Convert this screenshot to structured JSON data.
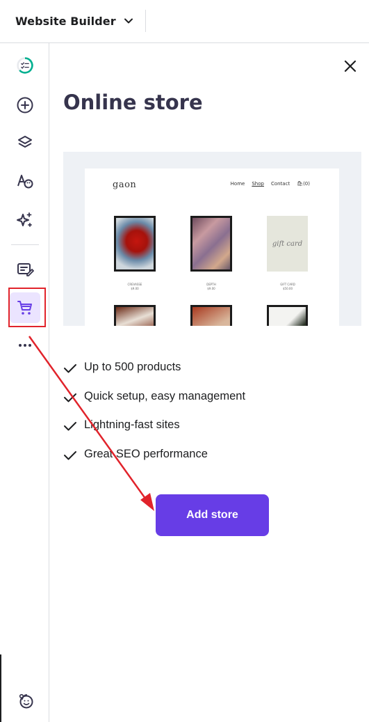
{
  "topbar": {
    "site_switcher_label": "Website Builder"
  },
  "rail": {
    "items": [
      {
        "name": "checklist",
        "icon": "progress-checklist-icon"
      },
      {
        "name": "add-elements",
        "icon": "plus-circle-icon"
      },
      {
        "name": "pages",
        "icon": "layers-icon"
      },
      {
        "name": "styles",
        "icon": "palette-icon"
      },
      {
        "name": "ai-tools",
        "icon": "sparkles-icon"
      },
      {
        "name": "blog",
        "icon": "edit-note-icon"
      },
      {
        "name": "online-store",
        "icon": "cart-icon",
        "active": true
      },
      {
        "name": "more",
        "icon": "more-dots-icon"
      },
      {
        "name": "help",
        "icon": "smiley-icon"
      }
    ]
  },
  "panel": {
    "title": "Online store",
    "preview": {
      "logo": "gaon",
      "nav": [
        "Home",
        "Shop",
        "Contact",
        "(0)"
      ],
      "products": [
        {
          "name": "CREVASSE",
          "price": "$9.00"
        },
        {
          "name": "DEPTH",
          "price": "$9.00"
        },
        {
          "name": "GIFT CARD",
          "price": "$50.00"
        }
      ],
      "gift_card_text": "gift card"
    },
    "features": [
      "Up to 500 products",
      "Quick setup, easy management",
      "Lightning-fast sites",
      "Great SEO performance"
    ],
    "cta_label": "Add store"
  },
  "colors": {
    "brand": "#673de6",
    "accent_green": "#00b090",
    "annotation_red": "#e1232b",
    "text_dark": "#1d1e20"
  }
}
